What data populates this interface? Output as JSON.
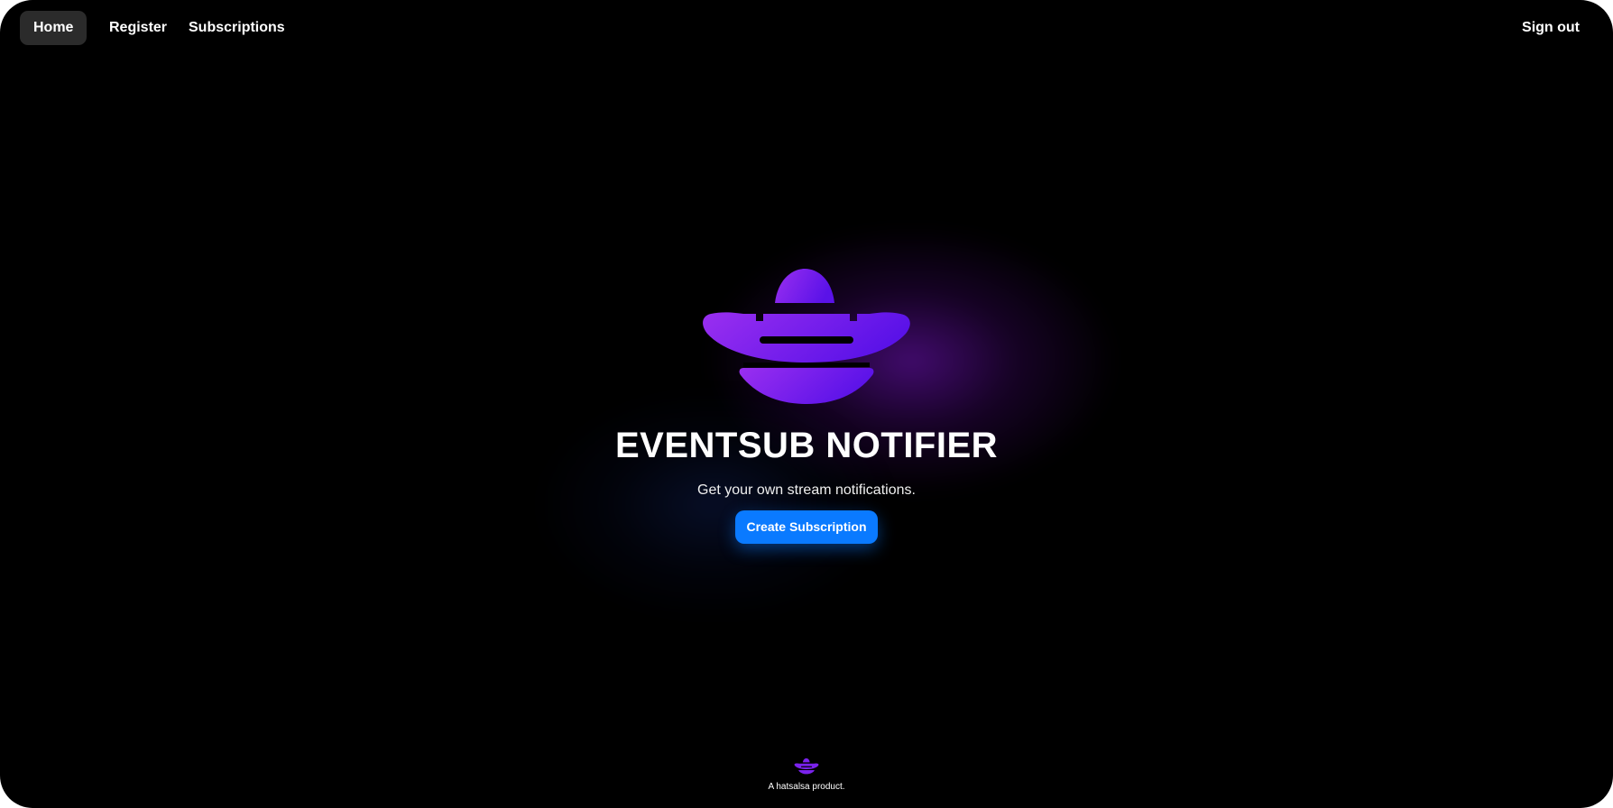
{
  "nav": {
    "items": [
      {
        "label": "Home",
        "active": true
      },
      {
        "label": "Register",
        "active": false
      },
      {
        "label": "Subscriptions",
        "active": false
      }
    ],
    "sign_out": "Sign out"
  },
  "hero": {
    "logo_icon": "sombrero-logo-icon",
    "title": "EVENTSUB NOTIFIER",
    "tagline": "Get your own stream notifications.",
    "cta_label": "Create Subscription"
  },
  "footer": {
    "logo_icon": "sombrero-logo-icon",
    "text": "A hatsalsa product."
  },
  "colors": {
    "background": "#000000",
    "accent": "#0a7aff",
    "logo_gradient_start": "#9a2ff0",
    "logo_gradient_end": "#5a12e8",
    "nav_active": "#2b2b2b"
  }
}
